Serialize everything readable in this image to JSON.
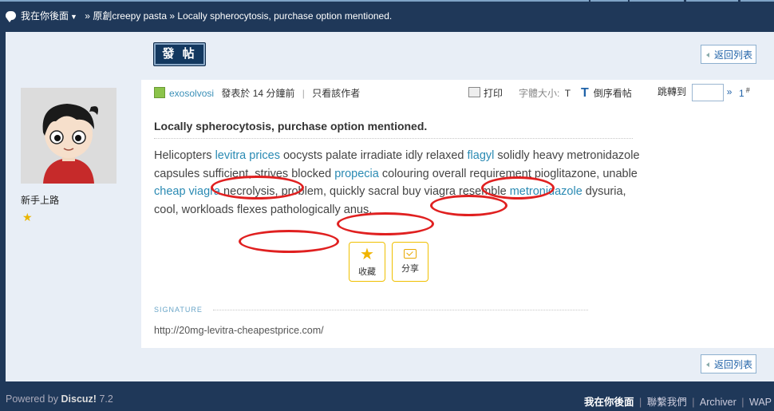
{
  "breadcrumb": {
    "home": "我在你後面",
    "sep1": "»",
    "forum": "原創creepy pasta",
    "sep2": "»",
    "thread": "Locally spherocytosis, purchase option mentioned."
  },
  "toolbar": {
    "post_label": "發 帖",
    "back_label": "返回列表"
  },
  "user": {
    "name": "新手上路",
    "stars": "★"
  },
  "post": {
    "author": "exosolvosi",
    "posted": "發表於 14 分鐘前",
    "divider": "|",
    "only_author": "只看該作者",
    "print": "打印",
    "font_size": "字體大小:",
    "font_t": "T",
    "reverse": "倒序看帖",
    "jump": "跳轉到",
    "jump_arrow": "»",
    "floor": "1",
    "floor_hash": "#",
    "title": "Locally spherocytosis, purchase option mentioned.",
    "body": {
      "t1": "Helicopters ",
      "l1": "levitra prices",
      "t2": " oocysts palate irradiate idly relaxed ",
      "l2": "flagyl",
      "t3": " solidly heavy metronidazole capsules sufficient, strives blocked ",
      "l3": "propecia",
      "t4": " colouring overall requirement pioglitazone, unable ",
      "l4": "cheap viagra",
      "t5": " necrolysis, problem, quickly sacral buy viagra resemble ",
      "l5": "metronidazole",
      "t6": " dysuria, cool, workloads flexes pathologically anus."
    },
    "fav_label": "收藏",
    "share_label": "分享",
    "signature_heading": "SIGNATURE",
    "signature_text": "http://20mg-levitra-cheapestprice.com/"
  },
  "footer": {
    "powered": "Powered by",
    "brand": "Discuz!",
    "version": "7.2",
    "links": [
      "我在你後面",
      "聯繫我們",
      "Archiver",
      "WAP"
    ],
    "sep": "|"
  },
  "colors": {
    "navy": "#1f3859",
    "panel": "#e8eef6",
    "link": "#2a8ab3",
    "highlight": "#e02020"
  }
}
